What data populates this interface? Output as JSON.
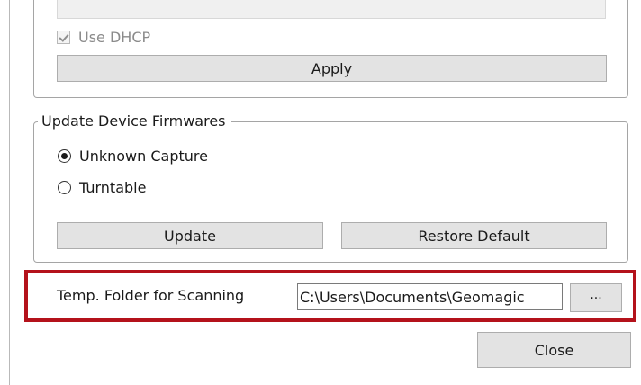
{
  "network": {
    "use_dhcp_label": "Use DHCP",
    "use_dhcp_checked": true,
    "apply_label": "Apply"
  },
  "firmware": {
    "group_title": "Update Device Firmwares",
    "options": [
      {
        "label": "Unknown Capture",
        "selected": true
      },
      {
        "label": "Turntable",
        "selected": false
      }
    ],
    "update_label": "Update",
    "restore_label": "Restore Default"
  },
  "temp_folder": {
    "label": "Temp. Folder for Scanning",
    "path_value": "C:\\Users\\Documents\\Geomagic",
    "browse_label": "..."
  },
  "close_label": "Close",
  "colors": {
    "highlight": "#b4121b",
    "button_bg": "#e3e3e3",
    "group_border": "#a5a5a5"
  }
}
